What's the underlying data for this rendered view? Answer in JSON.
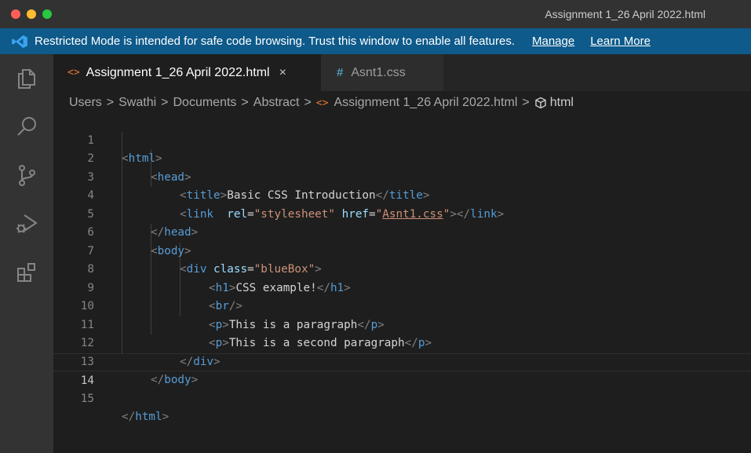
{
  "window": {
    "title": "Assignment 1_26 April 2022.html"
  },
  "banner": {
    "message": "Restricted Mode is intended for safe code browsing. Trust this window to enable all features.",
    "manage": "Manage",
    "learn_more": "Learn More"
  },
  "tabs": [
    {
      "label": "Assignment 1_26 April 2022.html",
      "icon": "<>",
      "close": "×"
    },
    {
      "label": "Asnt1.css",
      "icon": "#"
    }
  ],
  "breadcrumb": {
    "items": [
      "Users",
      "Swathi",
      "Documents",
      "Abstract",
      "Assignment 1_26 April 2022.html",
      "html"
    ],
    "separator": ">",
    "file_icon": "<>"
  },
  "editor": {
    "line_numbers": [
      "1",
      "2",
      "3",
      "4",
      "5",
      "6",
      "7",
      "8",
      "9",
      "10",
      "11",
      "12",
      "13",
      "14",
      "15"
    ],
    "current_line": 14,
    "code": {
      "l1": {
        "tag": "html"
      },
      "l2": {
        "tag": "head"
      },
      "l3": {
        "tag": "title",
        "text": "Basic CSS Introduction",
        "close": "title"
      },
      "l4": {
        "tag": "link",
        "attr1": "rel",
        "val1": "\"stylesheet\"",
        "attr2": "href",
        "q": "\"",
        "val2": "Asnt1.css",
        "close": "link"
      },
      "l5": {
        "tag": "head"
      },
      "l6": {
        "tag": "body"
      },
      "l7": {
        "tag": "div",
        "attr": "class",
        "val": "\"blueBox\""
      },
      "l8": {
        "tag": "h1",
        "text": "CSS example!",
        "close": "h1"
      },
      "l9": {
        "tag": "br"
      },
      "l10": {
        "tag": "p",
        "text": "This is a paragraph",
        "close": "p"
      },
      "l11": {
        "tag": "p",
        "text": "This is a second paragraph",
        "close": "p"
      },
      "l12": {
        "tag": "div"
      },
      "l13": {
        "tag": "body"
      },
      "l15": {
        "tag": "html"
      }
    }
  },
  "colors": {
    "banner": "#0e5a8a",
    "tag": "#569cd6",
    "attribute": "#9cdcfe",
    "string": "#ce9178",
    "html_icon": "#e37933",
    "css_icon": "#519aba"
  },
  "icons": {
    "activity": [
      "explorer-icon",
      "search-icon",
      "source-control-icon",
      "run-debug-icon",
      "extensions-icon"
    ]
  }
}
